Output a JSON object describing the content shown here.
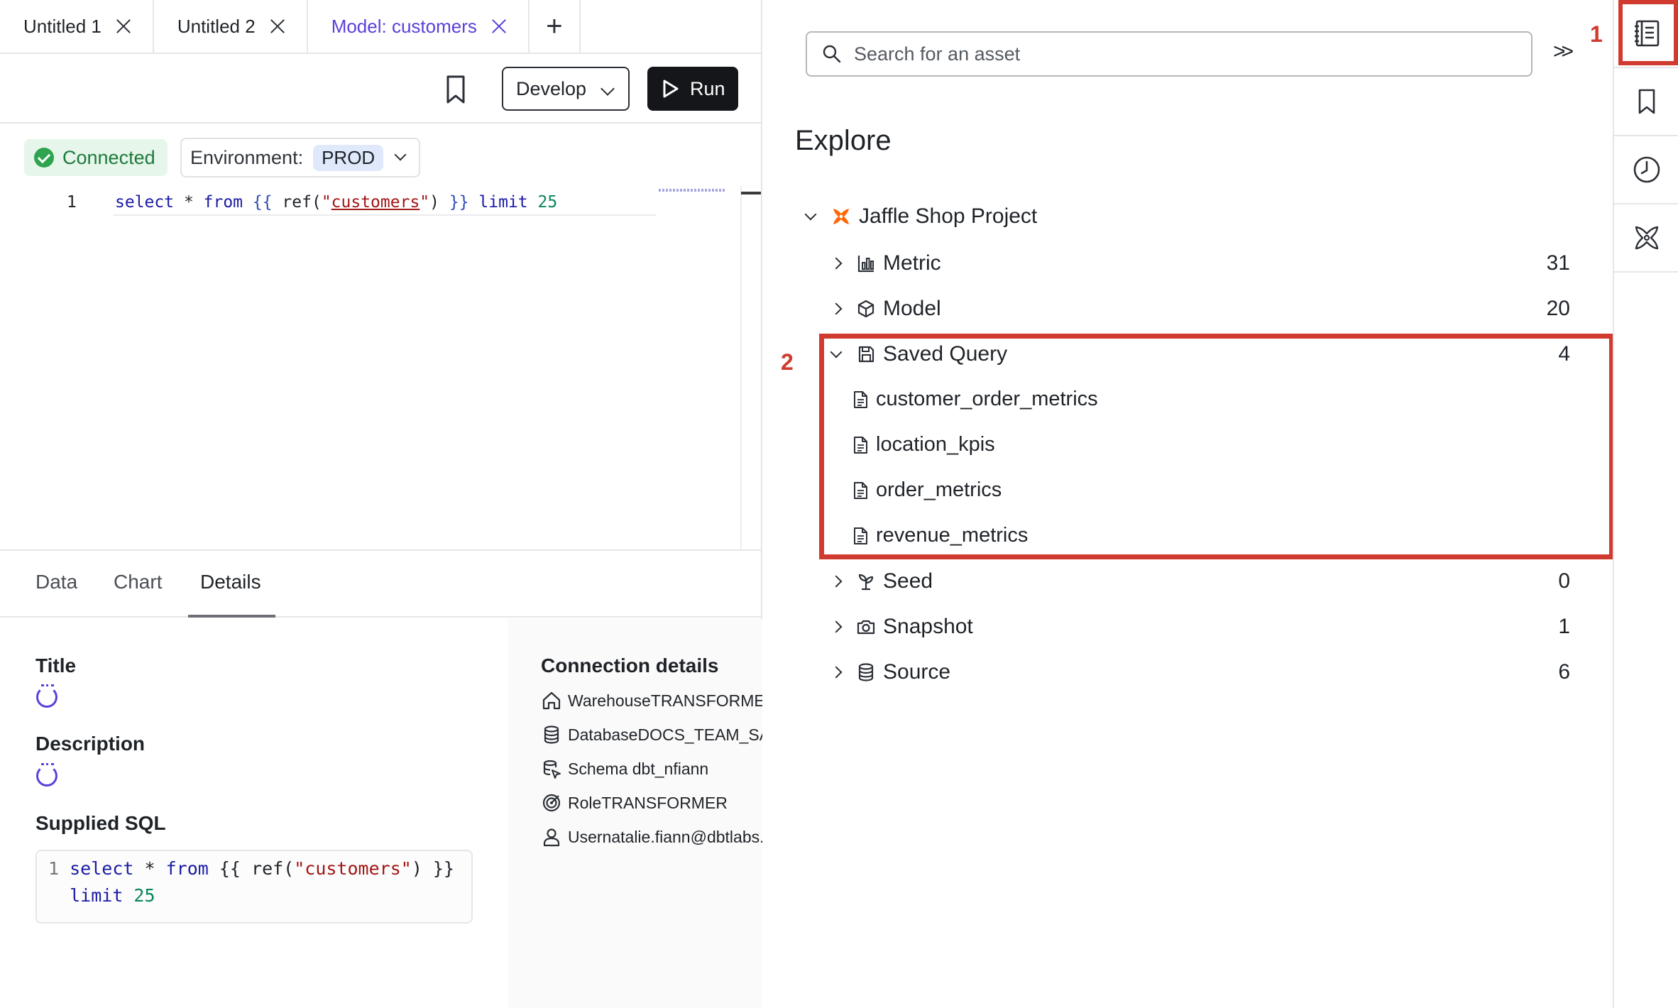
{
  "tabs": [
    {
      "label": "Untitled 1",
      "active": false
    },
    {
      "label": "Untitled 2",
      "active": false
    },
    {
      "label": "Model: customers",
      "active": true
    }
  ],
  "toolbar": {
    "develop_label": "Develop",
    "run_label": "Run"
  },
  "status": {
    "connected_label": "Connected",
    "environment_label": "Environment:",
    "environment_value": "PROD"
  },
  "editor": {
    "line_number": "1",
    "code": {
      "kw_select": "select",
      "star": " * ",
      "kw_from": "from",
      "open": " {{ ",
      "fn": "ref(",
      "quote1": "\"",
      "ref_name": "customers",
      "quote2": "\"",
      "close_paren": ")",
      "close": " }} ",
      "kw_limit": "limit",
      "num": " 25"
    }
  },
  "result_tabs": [
    "Data",
    "Chart",
    "Details"
  ],
  "details": {
    "title_label": "Title",
    "description_label": "Description",
    "supplied_sql_label": "Supplied SQL",
    "sql": {
      "line1_no": "1",
      "line1_kw_select": "select",
      "line1_rest_star": " * ",
      "line1_kw_from": "from",
      "line1_tpl": " {{ ref(",
      "line1_str": "\"customers\"",
      "line1_end": ") }}",
      "line2_kw_limit": "limit",
      "line2_num": " 25"
    },
    "connection_label": "Connection details",
    "connection": [
      {
        "icon": "warehouse-icon",
        "text": "WarehouseTRANSFORMER"
      },
      {
        "icon": "database-icon",
        "text": "DatabaseDOCS_TEAM_SANDBOX"
      },
      {
        "icon": "schema-icon",
        "text": "Schema  dbt_nfiann"
      },
      {
        "icon": "role-icon",
        "text": "RoleTRANSFORMER"
      },
      {
        "icon": "user-icon",
        "text": "Usernatalie.fiann@dbtlabs.com"
      }
    ]
  },
  "explore": {
    "search_placeholder": "Search for an asset",
    "collapse_label": ">>",
    "title": "Explore",
    "project": "Jaffle Shop Project",
    "groups": [
      {
        "label": "Metric",
        "count": "31",
        "icon": "metric-icon"
      },
      {
        "label": "Model",
        "count": "20",
        "icon": "model-icon"
      },
      {
        "label": "Saved Query",
        "count": "4",
        "icon": "saved-query-icon"
      },
      {
        "label": "Seed",
        "count": "0",
        "icon": "seed-icon"
      },
      {
        "label": "Snapshot",
        "count": "1",
        "icon": "snapshot-icon"
      },
      {
        "label": "Source",
        "count": "6",
        "icon": "source-icon"
      }
    ],
    "saved_queries": [
      "customer_order_metrics",
      "location_kpis",
      "order_metrics",
      "revenue_metrics"
    ]
  },
  "annotations": {
    "one": "1",
    "two": "2"
  },
  "colors": {
    "accent": "#5b3fd9",
    "highlight": "#d13a2e",
    "connected": "#1c7a3c",
    "dbt_orange": "#fe6703"
  }
}
